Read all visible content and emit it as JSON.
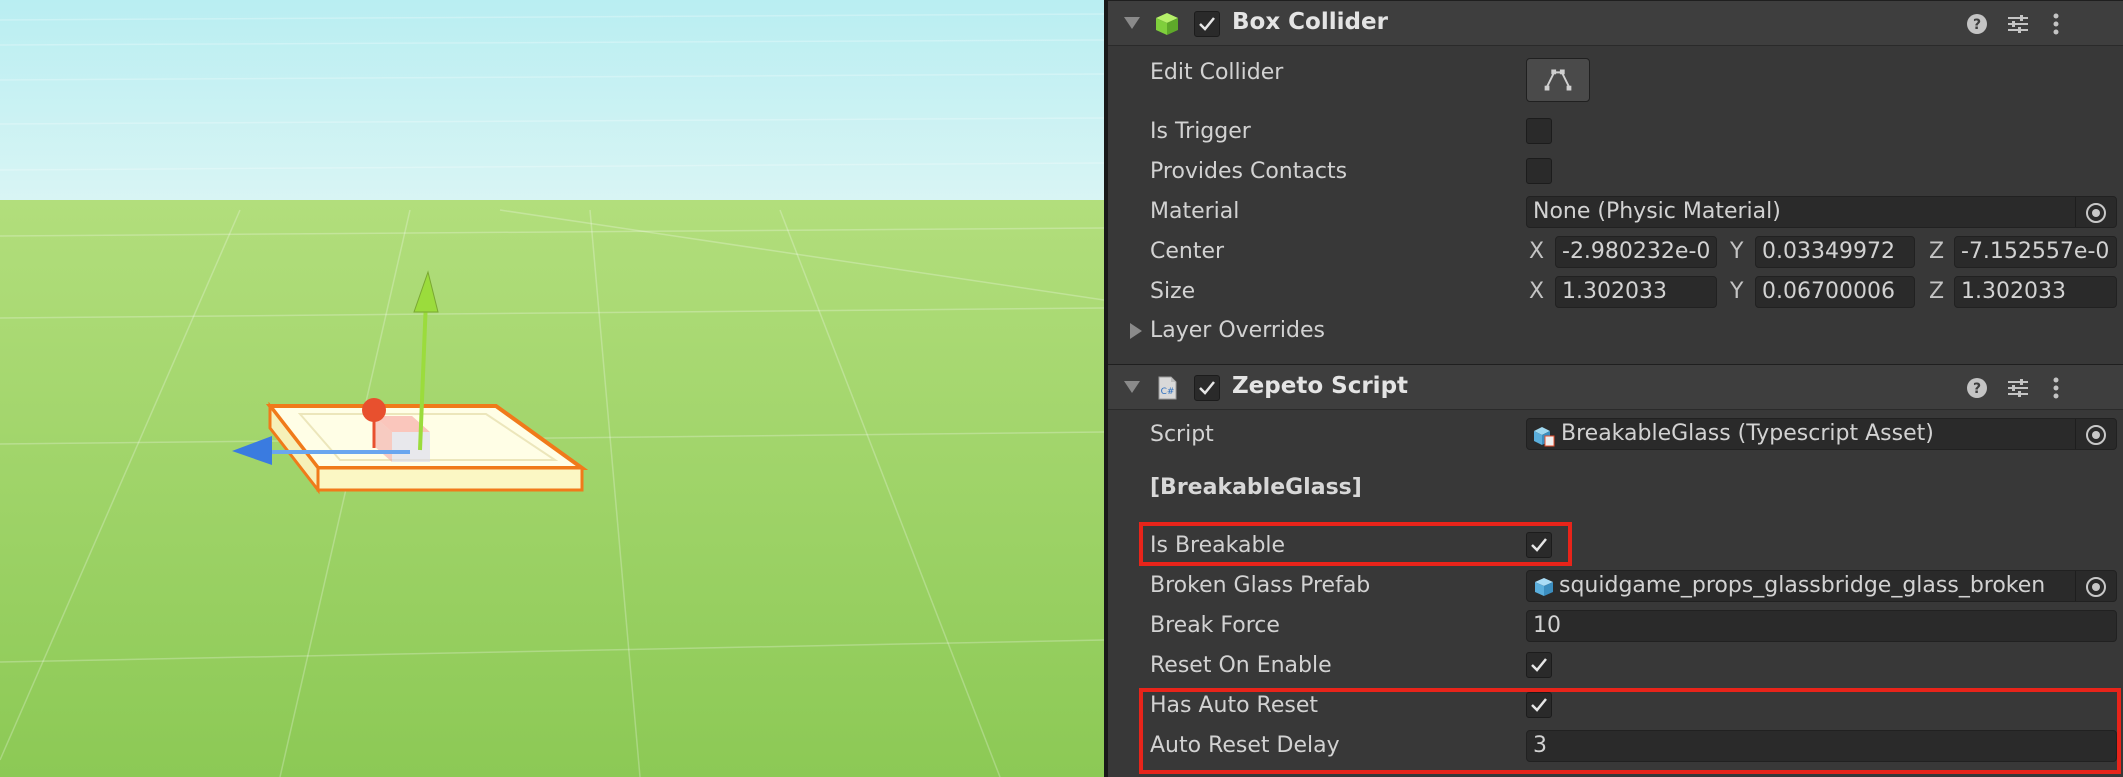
{
  "box_collider": {
    "title": "Box Collider",
    "icon": "cube-icon",
    "edit_collider_label": "Edit Collider",
    "is_trigger_label": "Is Trigger",
    "provides_contacts_label": "Provides Contacts",
    "material_label": "Material",
    "material_value": "None (Physic Material)",
    "center_label": "Center",
    "center": {
      "x": "-2.980232e-0",
      "y": "0.03349972",
      "z": "-7.152557e-0"
    },
    "size_label": "Size",
    "size": {
      "x": "1.302033",
      "y": "0.06700006",
      "z": "1.302033"
    },
    "layer_overrides_label": "Layer Overrides",
    "enabled": true,
    "is_trigger": false,
    "provides_contacts": false
  },
  "zepeto_script": {
    "title": "Zepeto Script",
    "icon": "script-file-icon",
    "script_label": "Script",
    "script_value": "BreakableGlass (Typescript Asset)",
    "section_header": "[BreakableGlass]",
    "is_breakable_label": "Is Breakable",
    "is_breakable": true,
    "broken_glass_prefab_label": "Broken Glass Prefab",
    "broken_glass_prefab_value": "squidgame_props_glassbridge_glass_broken",
    "break_force_label": "Break Force",
    "break_force_value": "10",
    "reset_on_enable_label": "Reset On Enable",
    "reset_on_enable": true,
    "has_auto_reset_label": "Has Auto Reset",
    "has_auto_reset": true,
    "auto_reset_delay_label": "Auto Reset Delay",
    "auto_reset_delay_value": "3",
    "enabled": true
  },
  "axis_labels": {
    "x": "X",
    "y": "Y",
    "z": "Z"
  },
  "colors": {
    "highlight": "#e8241a",
    "selection_outline": "#f07a1a",
    "gizmo_x": "#e8502e",
    "gizmo_y": "#9bdc3c",
    "gizmo_z": "#3a7be0",
    "sky": "#cdf0f3",
    "ground": "#9ed264"
  }
}
